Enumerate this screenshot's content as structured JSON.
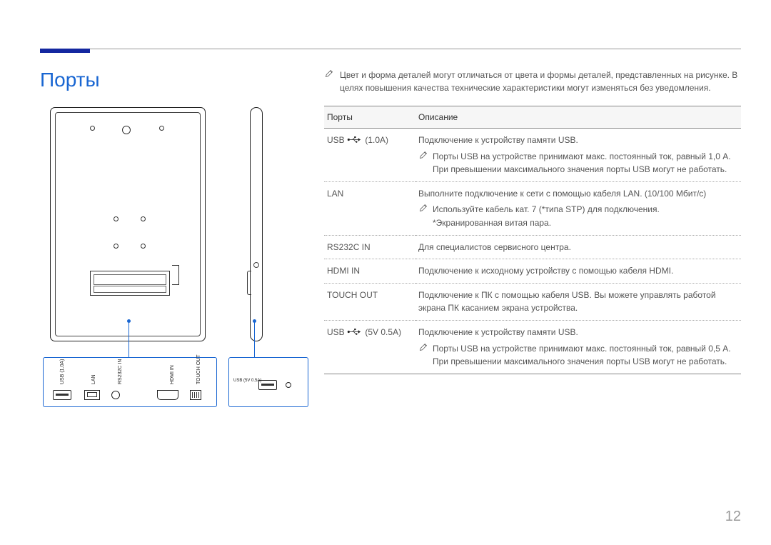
{
  "page_number": "12",
  "title": "Порты",
  "top_note": "Цвет и форма деталей могут отличаться от цвета и формы деталей, представленных на рисунке. В целях повышения качества технические характеристики могут изменяться без уведомления.",
  "table": {
    "headers": {
      "ports": "Порты",
      "desc": "Описание"
    },
    "rows": [
      {
        "port": "USB",
        "port_suffix": "(1.0A)",
        "has_usb_glyph": true,
        "desc": "Подключение к устройству памяти USB.",
        "note": "Порты USB на устройстве принимают макс. постоянный ток, равный 1,0 А. При превышении максимального значения порты USB могут не работать."
      },
      {
        "port": "LAN",
        "desc": "Выполните подключение к сети с помощью кабеля LAN. (10/100 Мбит/с)",
        "note": "Используйте кабель кат. 7 (*типа STP) для подключения.\n*Экранированная витая пара."
      },
      {
        "port": "RS232C IN",
        "desc": "Для специалистов сервисного центра."
      },
      {
        "port": "HDMI IN",
        "desc": "Подключение к исходному устройству с помощью кабеля HDMI."
      },
      {
        "port": "TOUCH OUT",
        "desc": "Подключение к ПК с помощью кабеля USB. Вы можете управлять работой экрана ПК касанием экрана устройства."
      },
      {
        "port": "USB",
        "port_suffix": "(5V 0.5A)",
        "has_usb_glyph": true,
        "desc": "Подключение к устройству памяти USB.",
        "note": "Порты USB на устройстве принимают макс. постоянный ток, равный 0,5 А. При превышении максимального значения порты USB могут не работать."
      }
    ]
  },
  "diagram_labels": {
    "usb_1": "USB\n(1.0A)",
    "lan": "LAN",
    "rs232c": "RS232C\nIN",
    "hdmi": "HDMI IN",
    "touch": "TOUCH\nOUT",
    "usb_2": "USB\n(5V 0.5A)"
  }
}
